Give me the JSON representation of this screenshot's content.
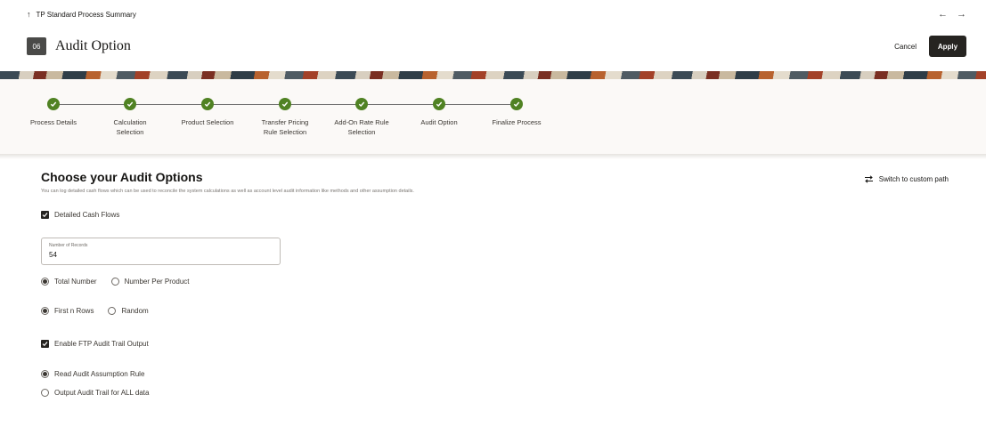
{
  "breadcrumb": {
    "label": "TP Standard Process Summary"
  },
  "nav": {
    "back": "←",
    "forward": "→"
  },
  "header": {
    "step_number": "06",
    "title": "Audit Option",
    "cancel_label": "Cancel",
    "apply_label": "Apply"
  },
  "train": {
    "stops": [
      {
        "label": "Process Details",
        "status": "complete"
      },
      {
        "label": "Calculation\nSelection",
        "status": "complete"
      },
      {
        "label": "Product Selection",
        "status": "complete"
      },
      {
        "label": "Transfer Pricing\nRule Selection",
        "status": "complete"
      },
      {
        "label": "Add-On Rate Rule\nSelection",
        "status": "complete"
      },
      {
        "label": "Audit Option",
        "status": "complete"
      },
      {
        "label": "Finalize Process",
        "status": "complete"
      }
    ]
  },
  "main": {
    "title": "Choose your Audit Options",
    "subtitle": "You can log detailed cash flows which can be used to reconcile the system calculations as well as account level audit information like methods and other assumption details.",
    "switch_label": "Switch to custom path",
    "detailed_cash_flows": {
      "label": "Detailed Cash Flows",
      "checked": true
    },
    "records_field": {
      "label": "Number of Records",
      "value": "54"
    },
    "count_mode": {
      "options": [
        "Total Number",
        "Number Per Product"
      ],
      "selected": "Total Number"
    },
    "row_mode": {
      "options": [
        "First n Rows",
        "Random"
      ],
      "selected": "First n Rows"
    },
    "ftp_audit": {
      "label": "Enable FTP Audit Trail Output",
      "checked": true
    },
    "audit_source": {
      "options": [
        "Read Audit Assumption Rule",
        "Output Audit Trail for ALL data"
      ],
      "selected": "Read Audit Assumption Rule"
    }
  },
  "colors": {
    "accent_green": "#508223",
    "primary_button": "#262421",
    "train_background": "#fbf9f7"
  }
}
